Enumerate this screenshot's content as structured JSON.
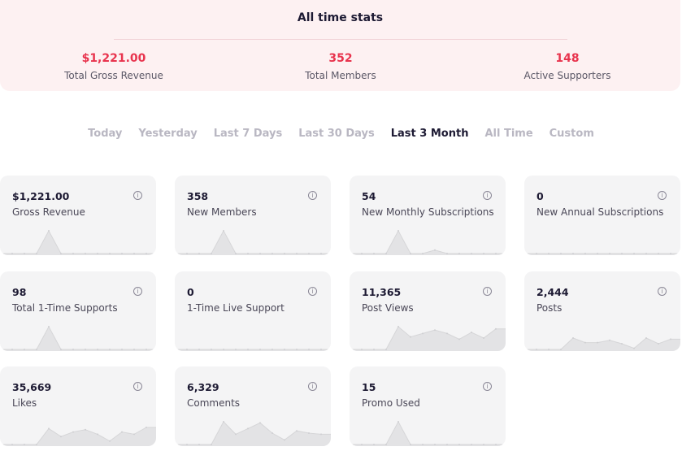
{
  "summary": {
    "title": "All time stats",
    "stats": [
      {
        "value": "$1,221.00",
        "label": "Total Gross Revenue"
      },
      {
        "value": "352",
        "label": "Total Members"
      },
      {
        "value": "148",
        "label": "Active Supporters"
      }
    ]
  },
  "filters": {
    "items": [
      "Today",
      "Yesterday",
      "Last 7 Days",
      "Last 30 Days",
      "Last 3 Month",
      "All Time",
      "Custom"
    ],
    "active": "Last 3 Month"
  },
  "cards": [
    {
      "value": "$1,221.00",
      "label": "Gross Revenue",
      "series": [
        0,
        0,
        0,
        0,
        1,
        0,
        0,
        0,
        0,
        0,
        0,
        0,
        0,
        0
      ]
    },
    {
      "value": "358",
      "label": "New Members",
      "series": [
        0,
        0,
        0,
        0,
        1,
        0,
        0,
        0,
        0,
        0,
        0,
        0,
        0,
        0
      ]
    },
    {
      "value": "54",
      "label": "New Monthly Subscriptions",
      "series": [
        0,
        0,
        0,
        0,
        1,
        0,
        0,
        0.15,
        0,
        0,
        0,
        0,
        0,
        0
      ]
    },
    {
      "value": "0",
      "label": "New Annual Subscriptions",
      "series": [
        0,
        0,
        0,
        0,
        0,
        0,
        0,
        0,
        0,
        0,
        0,
        0,
        0,
        0
      ]
    },
    {
      "value": "98",
      "label": "Total 1-Time Supports",
      "series": [
        0,
        0,
        0,
        0,
        1,
        0,
        0,
        0,
        0,
        0,
        0,
        0,
        0,
        0
      ]
    },
    {
      "value": "0",
      "label": "1-Time Live Support",
      "series": [
        0,
        0,
        0,
        0,
        0,
        0,
        0,
        0,
        0,
        0,
        0,
        0,
        0,
        0
      ]
    },
    {
      "value": "11,365",
      "label": "Post Views",
      "series": [
        0,
        0,
        0,
        0,
        1,
        0.55,
        0.7,
        0.85,
        0.7,
        0.45,
        0.75,
        0.5,
        0.9
      ]
    },
    {
      "value": "2,444",
      "label": "Posts",
      "series": [
        0,
        0,
        0,
        0,
        0.5,
        0.3,
        0.3,
        0.4,
        0.25,
        0.05,
        0.5,
        0.25,
        0.45
      ]
    },
    {
      "value": "35,669",
      "label": "Likes",
      "series": [
        0,
        0,
        0,
        0,
        0.7,
        0.35,
        0.55,
        0.65,
        0.45,
        0.15,
        0.55,
        0.45,
        0.75
      ]
    },
    {
      "value": "6,329",
      "label": "Comments",
      "series": [
        0,
        0,
        0,
        0,
        1,
        0.45,
        0.7,
        0.95,
        0.5,
        0.2,
        0.6,
        0.5,
        0.45
      ]
    },
    {
      "value": "15",
      "label": "Promo Used",
      "series": [
        0,
        0,
        0,
        0,
        1,
        0,
        0,
        0,
        0,
        0,
        0,
        0,
        0,
        0
      ]
    }
  ]
}
